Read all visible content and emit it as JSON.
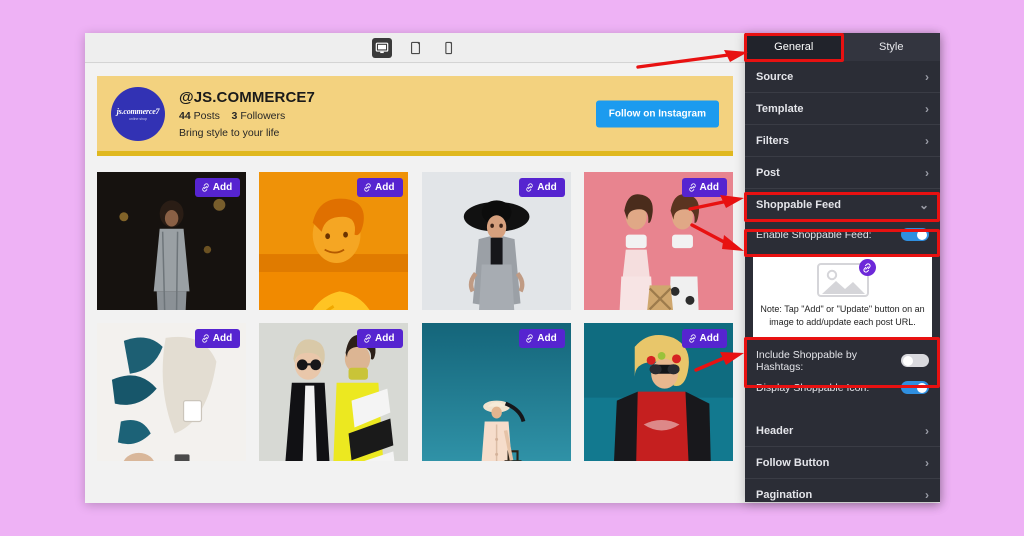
{
  "toolbar": {
    "devices": [
      {
        "name": "desktop-preview",
        "label": "Desktop",
        "active": true
      },
      {
        "name": "tablet-preview",
        "label": "Tablet",
        "active": false
      },
      {
        "name": "mobile-preview",
        "label": "Mobile",
        "active": false
      }
    ]
  },
  "feed": {
    "profile": {
      "avatar_text": "js.commerce7",
      "avatar_subtext": "online shop",
      "username": "@JS.COMMERCE7",
      "posts_count": "44",
      "posts_label": "Posts",
      "followers_count": "3",
      "followers_label": "Followers",
      "bio": "Bring style to your life",
      "follow_button": "Follow on Instagram"
    },
    "add_button_label": "Add",
    "tiles": [
      {
        "alt": "woman-in-grey-jumpsuit-at-night"
      },
      {
        "alt": "woman-in-orange-duotone-portrait"
      },
      {
        "alt": "woman-in-grey-suit-with-black-hat"
      },
      {
        "alt": "two-women-on-pink-background"
      },
      {
        "alt": "flatlay-denim-and-boots"
      },
      {
        "alt": "two-women-in-black-and-yellow-coats"
      },
      {
        "alt": "woman-with-suitcase-in-field"
      },
      {
        "alt": "woman-in-red-sweatshirt-with-sunglasses"
      }
    ]
  },
  "panel": {
    "tabs": [
      {
        "label": "General",
        "active": true
      },
      {
        "label": "Style",
        "active": false
      }
    ],
    "sections_top": [
      {
        "label": "Source",
        "icon": "chevron-right-icon"
      },
      {
        "label": "Template",
        "icon": "chevron-right-icon"
      },
      {
        "label": "Filters",
        "icon": "chevron-right-icon"
      },
      {
        "label": "Post",
        "icon": "chevron-right-icon"
      }
    ],
    "shoppable": {
      "label": "Shoppable Feed",
      "icon": "chevron-down-icon",
      "enable": {
        "label": "Enable Shoppable Feed:",
        "state": "on"
      },
      "note": "Note: Tap \"Add\" or \"Update\" button on an image to add/update each post URL.",
      "note_icon": "image-placeholder-icon",
      "note_badge_icon": "link-badge-icon",
      "hashtags": {
        "label": "Include Shoppable by Hashtags:",
        "state": "off"
      },
      "display_icon": {
        "label": "Display Shoppable Icon:",
        "state": "on"
      }
    },
    "sections_bottom": [
      {
        "label": "Header",
        "icon": "chevron-right-icon"
      },
      {
        "label": "Follow Button",
        "icon": "chevron-right-icon"
      },
      {
        "label": "Pagination",
        "icon": "chevron-right-icon"
      }
    ]
  },
  "colors": {
    "page_background": "#eeb2f5",
    "panel_background": "#2b2d36",
    "accent_toggle_on": "#2f8fe0",
    "add_button": "#5624d0",
    "follow_button": "#1c9bef",
    "profile_banner": "#f3d27f",
    "annotation": "#e81111"
  },
  "annotations": {
    "highlights": [
      "general-tab",
      "shoppable-feed-row",
      "enable-shoppable-feed-row",
      "shoppable-toggles-group"
    ],
    "arrows": [
      "arrow-to-general-tab",
      "arrow-to-shoppable-feed",
      "arrow-to-enable-shoppable",
      "arrow-to-toggles"
    ]
  }
}
